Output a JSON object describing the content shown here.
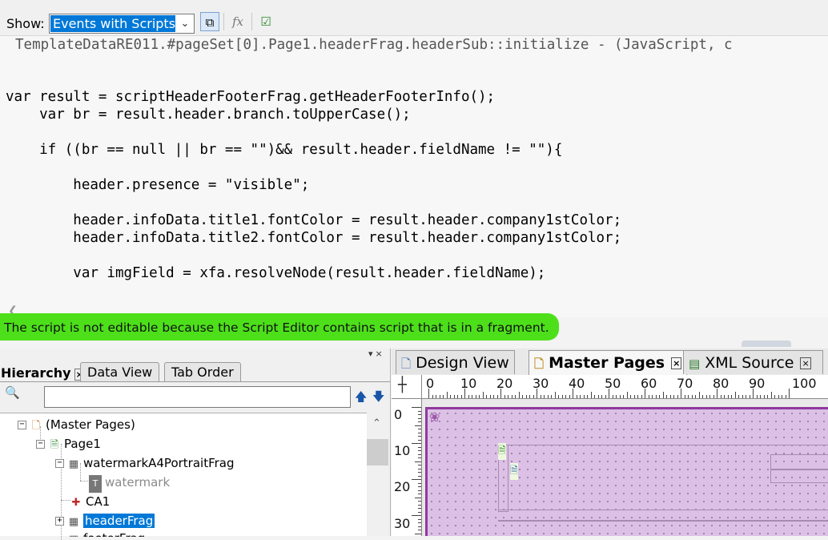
{
  "toolbar": {
    "show_label": "Show:",
    "show_value": "Events with Scripts",
    "icons": [
      "dropdown-arrow-icon",
      "show-all-events-icon",
      "function-icon",
      "check-script-icon"
    ]
  },
  "code": {
    "header": "TemplateDataRE011.#pageSet[0].Page1.headerFrag.headerSub::initialize - (JavaScript, c",
    "lines": [
      "var result = scriptHeaderFooterFrag.getHeaderFooterInfo();",
      "    var br = result.header.branch.toUpperCase();",
      "    if ((br == null || br == \"\")&& result.header.fieldName != \"\"){",
      "        header.presence = \"visible\";",
      "        header.infoData.title1.fontColor = result.header.company1stColor;",
      "        header.infoData.title2.fontColor = result.header.company1stColor;",
      "        var imgField = xfa.resolveNode(result.header.fieldName);"
    ]
  },
  "notice": "The script is not editable because the Script Editor contains script that is in a fragment.",
  "hierarchy": {
    "tabs": [
      "Hierarchy",
      "Data View",
      "Tab Order"
    ],
    "tree": [
      {
        "label": "(Master Pages)",
        "icon": "master-pages-icon"
      },
      {
        "label": "Page1",
        "icon": "page-icon"
      },
      {
        "label": "watermarkA4PortraitFrag",
        "icon": "fragment-icon"
      },
      {
        "label": "watermark",
        "icon": "text-field-icon"
      },
      {
        "label": "CA1",
        "icon": "content-area-icon"
      },
      {
        "label": "headerFrag",
        "icon": "fragment-icon"
      },
      {
        "label": "footerFrag",
        "icon": "fragment-icon"
      }
    ]
  },
  "design": {
    "tabs": [
      "Design View",
      "Master Pages",
      "XML Source"
    ],
    "ruler_h": [
      "0",
      "10",
      "20",
      "30",
      "40",
      "50",
      "60",
      "70",
      "80",
      "90",
      "100"
    ],
    "ruler_v": [
      "0",
      "10",
      "20",
      "30"
    ],
    "colors": {
      "page_fill": "#dcc0e6",
      "page_border": "#8f3a9e"
    }
  },
  "colors": {
    "selection": "#0078d7",
    "highlight": "#4de01a"
  }
}
